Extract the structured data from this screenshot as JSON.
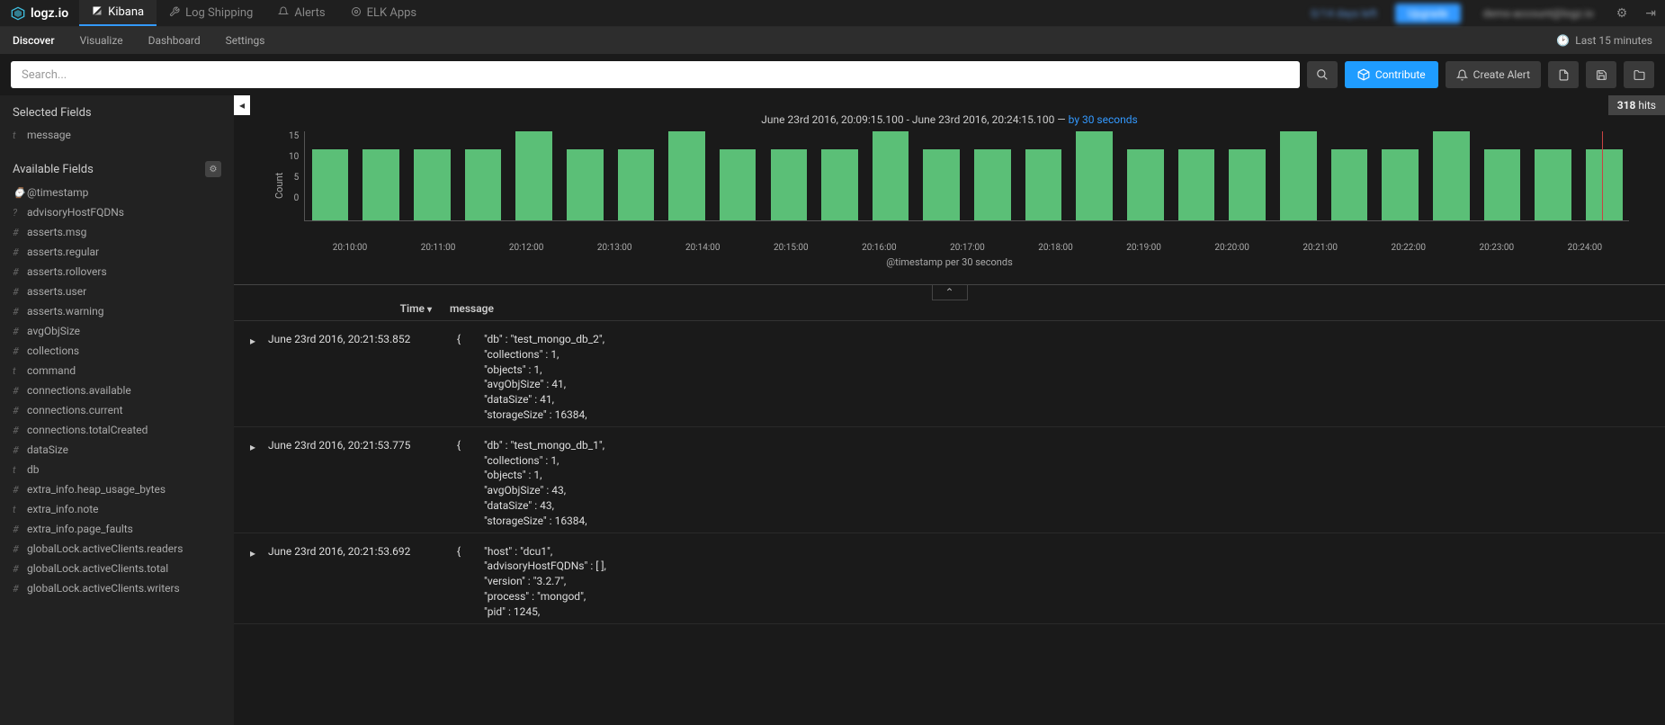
{
  "brand": "logz.io",
  "top_nav": {
    "items": [
      "Kibana",
      "Log Shipping",
      "Alerts",
      "ELK Apps"
    ],
    "active_index": 0,
    "trial_text": "0/14 days left",
    "upgrade_label": "Upgrade",
    "user_text": "demo-account@logz.io"
  },
  "sub_nav": {
    "items": [
      "Discover",
      "Visualize",
      "Dashboard",
      "Settings"
    ],
    "active_index": 0,
    "time_label": "Last 15 minutes"
  },
  "search": {
    "placeholder": "Search...",
    "contribute_label": "Contribute",
    "create_alert_label": "Create Alert"
  },
  "hits": {
    "count": "318",
    "label": "hits"
  },
  "sidebar": {
    "selected_title": "Selected Fields",
    "selected": [
      {
        "type": "t",
        "name": "message"
      }
    ],
    "available_title": "Available Fields",
    "available": [
      {
        "type": "⌚",
        "name": "@timestamp"
      },
      {
        "type": "?",
        "name": "advisoryHostFQDNs"
      },
      {
        "type": "#",
        "name": "asserts.msg"
      },
      {
        "type": "#",
        "name": "asserts.regular"
      },
      {
        "type": "#",
        "name": "asserts.rollovers"
      },
      {
        "type": "#",
        "name": "asserts.user"
      },
      {
        "type": "#",
        "name": "asserts.warning"
      },
      {
        "type": "#",
        "name": "avgObjSize"
      },
      {
        "type": "#",
        "name": "collections"
      },
      {
        "type": "t",
        "name": "command"
      },
      {
        "type": "#",
        "name": "connections.available"
      },
      {
        "type": "#",
        "name": "connections.current"
      },
      {
        "type": "#",
        "name": "connections.totalCreated"
      },
      {
        "type": "#",
        "name": "dataSize"
      },
      {
        "type": "t",
        "name": "db"
      },
      {
        "type": "#",
        "name": "extra_info.heap_usage_bytes"
      },
      {
        "type": "t",
        "name": "extra_info.note"
      },
      {
        "type": "#",
        "name": "extra_info.page_faults"
      },
      {
        "type": "#",
        "name": "globalLock.activeClients.readers"
      },
      {
        "type": "#",
        "name": "globalLock.activeClients.total"
      },
      {
        "type": "#",
        "name": "globalLock.activeClients.writers"
      }
    ]
  },
  "chart": {
    "title_prefix": "June 23rd 2016, 20:09:15.100 - June 23rd 2016, 20:24:15.100 — ",
    "interval_text": "by 30 seconds",
    "y_label": "Count",
    "x_label": "@timestamp per 30 seconds"
  },
  "chart_data": {
    "type": "bar",
    "title": "June 23rd 2016, 20:09:15.100 - June 23rd 2016, 20:24:15.100 — by 30 seconds",
    "ylabel": "Count",
    "xlabel": "@timestamp per 30 seconds",
    "ylim": [
      0,
      15
    ],
    "y_ticks": [
      0,
      5,
      10,
      15
    ],
    "x_ticks": [
      "20:10:00",
      "20:11:00",
      "20:12:00",
      "20:13:00",
      "20:14:00",
      "20:15:00",
      "20:16:00",
      "20:17:00",
      "20:18:00",
      "20:19:00",
      "20:20:00",
      "20:21:00",
      "20:22:00",
      "20:23:00",
      "20:24:00"
    ],
    "values": [
      12,
      12,
      12,
      12,
      15,
      12,
      12,
      15,
      12,
      12,
      12,
      15,
      12,
      12,
      12,
      15,
      12,
      12,
      12,
      15,
      12,
      12,
      15,
      12,
      12,
      12
    ],
    "color": "#5bbf77"
  },
  "table": {
    "col_time": "Time",
    "col_msg": "message"
  },
  "logs": [
    {
      "time": "June 23rd 2016, 20:21:53.852",
      "lines": "\"db\" : \"test_mongo_db_2\",\n\"collections\" : 1,\n\"objects\" : 1,\n\"avgObjSize\" : 41,\n\"dataSize\" : 41,\n\"storageSize\" : 16384,"
    },
    {
      "time": "June 23rd 2016, 20:21:53.775",
      "lines": "\"db\" : \"test_mongo_db_1\",\n\"collections\" : 1,\n\"objects\" : 1,\n\"avgObjSize\" : 43,\n\"dataSize\" : 43,\n\"storageSize\" : 16384,"
    },
    {
      "time": "June 23rd 2016, 20:21:53.692",
      "lines": "\"host\" : \"dcu1\",\n\"advisoryHostFQDNs\" : [ ],\n\"version\" : \"3.2.7\",\n\"process\" : \"mongod\",\n\"pid\" : 1245,"
    }
  ]
}
